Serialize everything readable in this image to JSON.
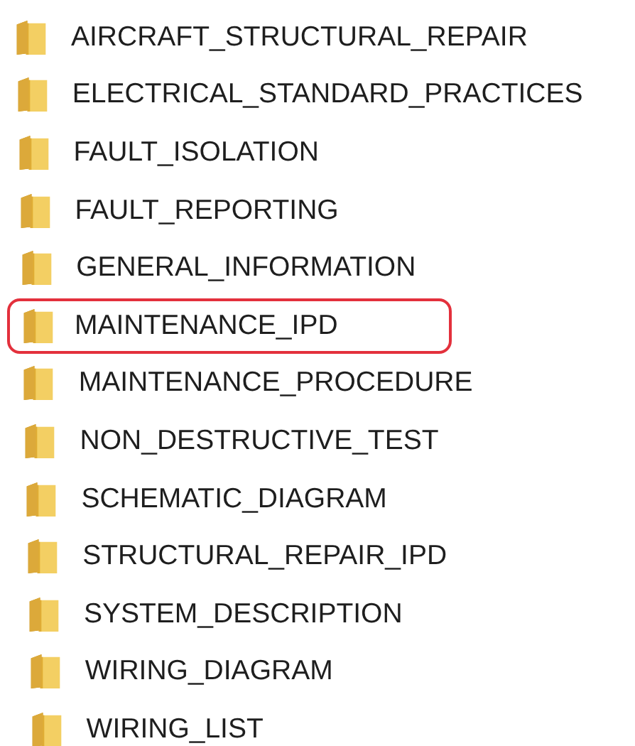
{
  "folders": [
    {
      "name": "AIRCRAFT_STRUCTURAL_REPAIR",
      "highlighted": false
    },
    {
      "name": "ELECTRICAL_STANDARD_PRACTICES",
      "highlighted": false
    },
    {
      "name": "FAULT_ISOLATION",
      "highlighted": false
    },
    {
      "name": "FAULT_REPORTING",
      "highlighted": false
    },
    {
      "name": "GENERAL_INFORMATION",
      "highlighted": false
    },
    {
      "name": "MAINTENANCE_IPD",
      "highlighted": true
    },
    {
      "name": "MAINTENANCE_PROCEDURE",
      "highlighted": false
    },
    {
      "name": "NON_DESTRUCTIVE_TEST",
      "highlighted": false
    },
    {
      "name": "SCHEMATIC_DIAGRAM",
      "highlighted": false
    },
    {
      "name": "STRUCTURAL_REPAIR_IPD",
      "highlighted": false
    },
    {
      "name": "SYSTEM_DESCRIPTION",
      "highlighted": false
    },
    {
      "name": "WIRING_DIAGRAM",
      "highlighted": false
    },
    {
      "name": "WIRING_LIST",
      "highlighted": false
    }
  ]
}
